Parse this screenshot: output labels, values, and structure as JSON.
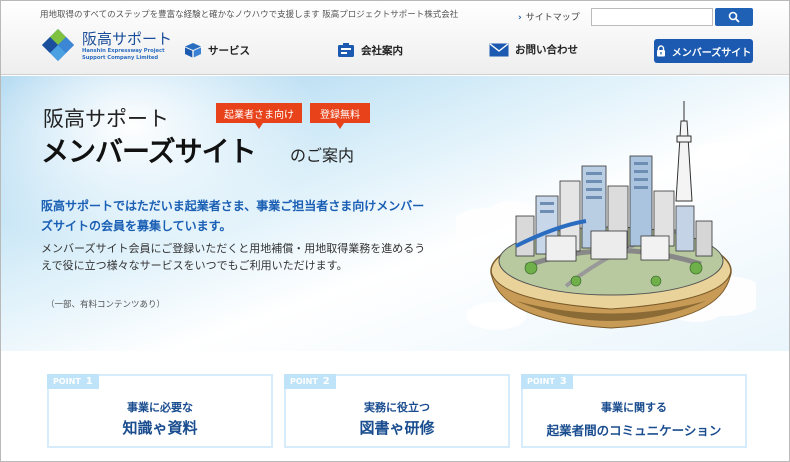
{
  "header": {
    "tagline": "用地取得のすべてのステップを豊富な経験と確かなノウハウで支援します 阪高プロジェクトサポート株式会社",
    "sitemap_label": "サイトマップ",
    "search_placeholder": "",
    "search_icon": "search-icon",
    "logo_jp": "阪高サポート",
    "logo_en": "Hanshin Expressway Project Support Company Limited"
  },
  "nav": {
    "items": [
      {
        "label": "サービス",
        "icon": "box-icon"
      },
      {
        "label": "会社案内",
        "icon": "building-icon"
      },
      {
        "label": "お問い合わせ",
        "icon": "mail-icon"
      }
    ],
    "member_button": "メンバーズサイト",
    "member_icon": "lock-icon"
  },
  "hero": {
    "title_line1": "阪高サポート",
    "title_line2": "メンバーズサイト",
    "title_suffix": "のご案内",
    "badge1": "起業者さま向け",
    "badge2": "登録無料",
    "lead": "阪高サポートではただいま起業者さま、事業ご担当者さま向けメンバーズサイトの会員を募集しています。",
    "body": "メンバーズサイト会員にご登録いただくと用地補償・用地取得業務を進めるうえで役に立つ様々なサービスをいつでもご利用いただけます。",
    "note": "（一部、有料コンテンツあり）"
  },
  "points": [
    {
      "tag": "POINT",
      "num": "1",
      "line1": "事業に必要な",
      "line2": "知識ゃ資料"
    },
    {
      "tag": "POINT",
      "num": "2",
      "line1": "実務に役立つ",
      "line2": "図書ゃ研修"
    },
    {
      "tag": "POINT",
      "num": "3",
      "line1": "事業に関する",
      "line2": "起業者間のコミュニケーション"
    }
  ],
  "colors": {
    "brand_blue": "#1b5ab0",
    "badge_red": "#e8421b",
    "lead_blue": "#1a5fb4"
  }
}
